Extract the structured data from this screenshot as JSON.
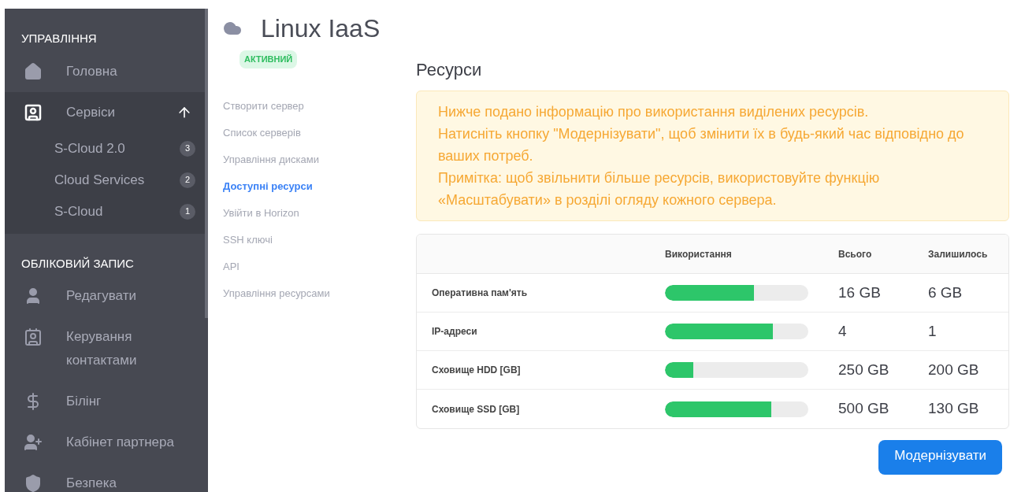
{
  "sidebar": {
    "sections": [
      {
        "heading": "УПРАВЛІННЯ",
        "items": [
          {
            "label": "Головна",
            "expanded": false
          },
          {
            "label": "Сервіси",
            "expanded": true,
            "children": [
              {
                "label": "S-Cloud 2.0",
                "badge": "3"
              },
              {
                "label": "Cloud Services",
                "badge": "2"
              },
              {
                "label": "S-Cloud",
                "badge": "1"
              }
            ]
          }
        ]
      },
      {
        "heading": "ОБЛІКОВИЙ ЗАПИС",
        "items": [
          {
            "label": "Редагувати",
            "expanded": false
          },
          {
            "label": "Керування контактами",
            "expanded": false
          },
          {
            "label": "Білінг",
            "expanded": false
          },
          {
            "label": "Кабінет партнера",
            "expanded": false
          },
          {
            "label": "Безпека",
            "expanded": false
          }
        ]
      }
    ]
  },
  "header": {
    "title": "Linux IaaS",
    "status": "АКТИВНИЙ"
  },
  "nav": [
    {
      "label": "Створити сервер",
      "selected": false
    },
    {
      "label": "Список серверів",
      "selected": false
    },
    {
      "label": "Управління дисками",
      "selected": false
    },
    {
      "label": "Доступні ресурси",
      "selected": true
    },
    {
      "label": "Увійти в Horizon",
      "selected": false
    },
    {
      "label": "SSH ключі",
      "selected": false
    },
    {
      "label": "API",
      "selected": false
    },
    {
      "label": "Управління ресурсами",
      "selected": false
    }
  ],
  "resources": {
    "title": "Ресурси",
    "notice": [
      "Нижче подано інформацію про використання виділених ресурсів.",
      "Натисніть кнопку \"Модернізувати\", щоб змінити їх в будь-який час відповідно до ваших потреб.",
      "Примітка: щоб звільнити більше ресурсів, використовуйте функцію «Масштабувати» в розділі огляду кожного сервера."
    ],
    "columns": [
      "Використання",
      "Всього",
      "Залишилось"
    ],
    "rows": [
      {
        "name": "Оперативна пам'ять",
        "level": 0.62,
        "total": "16 GB",
        "remaining": "6 GB"
      },
      {
        "name": "IP-адреси",
        "level": 0.75,
        "total": "4",
        "remaining": "1"
      },
      {
        "name": "Сховище HDD [GB]",
        "level": 0.2,
        "total": "250 GB",
        "remaining": "200 GB"
      },
      {
        "name": "Сховище SSD [GB]",
        "level": 0.74,
        "total": "500 GB",
        "remaining": "130 GB"
      }
    ],
    "button": "Модернізувати"
  }
}
